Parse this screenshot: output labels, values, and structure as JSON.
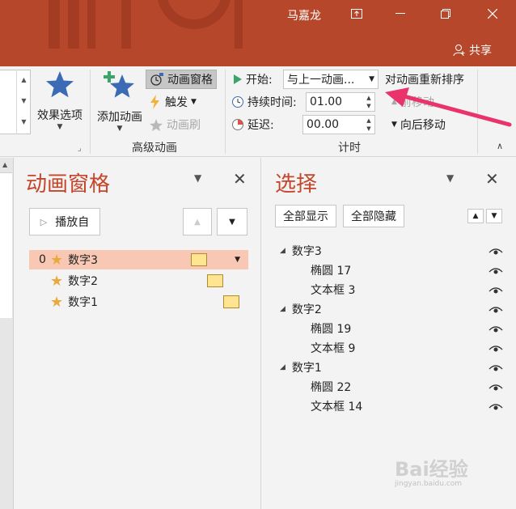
{
  "window": {
    "username": "马嘉龙",
    "share_label": "共享"
  },
  "ribbon": {
    "effect_options_label": "效果选项",
    "add_animation_label": "添加动画",
    "animation_pane_label": "动画窗格",
    "trigger_label": "触发",
    "animation_painter_label": "动画刷",
    "advanced_group_label": "高级动画",
    "start_label": "开始:",
    "start_value": "与上一动画...",
    "duration_label": "持续时间:",
    "duration_value": "01.00",
    "delay_label": "延迟:",
    "delay_value": "00.00",
    "reorder_label": "对动画重新排序",
    "move_earlier_label": "前移动",
    "move_later_label": "向后移动",
    "timing_group_label": "计时"
  },
  "animation_pane": {
    "title": "动画窗格",
    "play_label": "播放自",
    "items": [
      {
        "num": "0",
        "label": "数字3"
      },
      {
        "num": "",
        "label": "数字2"
      },
      {
        "num": "",
        "label": "数字1"
      }
    ]
  },
  "selection_pane": {
    "title": "选择",
    "show_all_label": "全部显示",
    "hide_all_label": "全部隐藏",
    "tree": [
      {
        "label": "数字3",
        "children": [
          "椭圆 17",
          "文本框 3"
        ]
      },
      {
        "label": "数字2",
        "children": [
          "椭圆 19",
          "文本框 9"
        ]
      },
      {
        "label": "数字1",
        "children": [
          "椭圆 22",
          "文本框 14"
        ]
      }
    ]
  },
  "watermark": {
    "brand": "Bai经验",
    "url": "jingyan.baidu.com"
  },
  "colors": {
    "titlebar": "#b7472a",
    "pane_title": "#c4462b",
    "selected_row": "#f9c8b4",
    "arrow": "#e8336b",
    "star": "#e9a93b"
  }
}
